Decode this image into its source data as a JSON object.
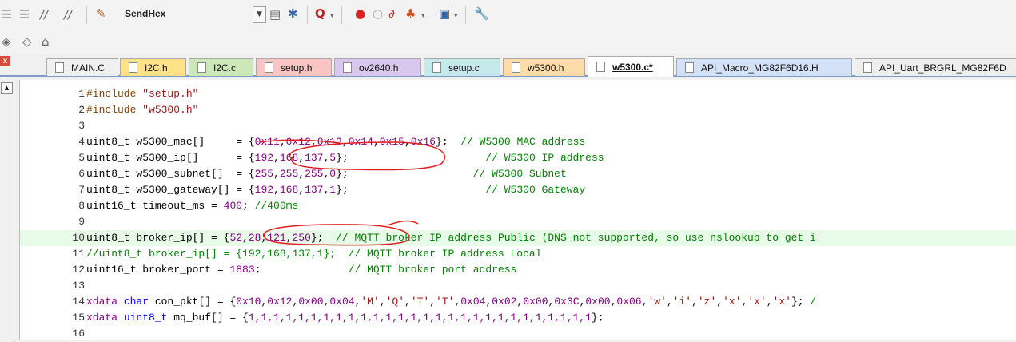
{
  "toolbar": {
    "combo_value": "SendHex",
    "icons": [
      "indent-icon",
      "outdent-icon",
      "comment-icon",
      "uncomment-icon",
      "wizard-icon",
      "combo-dropdown-icon",
      "find-in-files-icon",
      "replace-icon",
      "debug-icon",
      "breakpoint-icon",
      "breakpoint-disable-icon",
      "breakpoint-kill-icon",
      "breakpoint-all-icon",
      "window-icon",
      "settings-icon",
      "bookmark-icon",
      "bookmark-prev-icon",
      "bookmark-next-icon"
    ]
  },
  "tabs": [
    {
      "label": "MAIN.C",
      "color": "#f0f0f0",
      "active": false
    },
    {
      "label": "I2C.h",
      "color": "#fde28a",
      "active": false
    },
    {
      "label": "I2C.c",
      "color": "#cde8b8",
      "active": false
    },
    {
      "label": "setup.h",
      "color": "#f9c4c4",
      "active": false
    },
    {
      "label": "ov2640.h",
      "color": "#d8c8ee",
      "active": false
    },
    {
      "label": "setup.c",
      "color": "#c6e9ec",
      "active": false
    },
    {
      "label": "w5300.h",
      "color": "#fcdca8",
      "active": false
    },
    {
      "label": "w5300.c*",
      "color": "#ffffff",
      "active": true
    },
    {
      "label": "API_Macro_MG82F6D16.H",
      "color": "#d4e2f8",
      "active": false
    },
    {
      "label": "API_Uart_BRGRL_MG82F6D",
      "color": "#eeeeee",
      "active": false
    }
  ],
  "lines": [
    {
      "n": "1",
      "parts": [
        [
          "pp",
          "#include "
        ],
        [
          "str",
          "\"setup.h\""
        ]
      ]
    },
    {
      "n": "2",
      "parts": [
        [
          "pp",
          "#include "
        ],
        [
          "str",
          "\"w5300.h\""
        ]
      ]
    },
    {
      "n": "3",
      "parts": []
    },
    {
      "n": "4",
      "parts": [
        [
          "",
          "uint8_t w5300_mac[]     = {"
        ],
        [
          "num",
          "0x11"
        ],
        [
          "",
          ","
        ],
        [
          "num",
          "0x12"
        ],
        [
          "",
          ","
        ],
        [
          "num",
          "0x13"
        ],
        [
          "",
          ","
        ],
        [
          "num",
          "0x14"
        ],
        [
          "",
          ","
        ],
        [
          "num",
          "0x15"
        ],
        [
          "",
          ","
        ],
        [
          "num",
          "0x16"
        ],
        [
          "",
          "};  "
        ],
        [
          "cmt",
          "// W5300 MAC address"
        ]
      ]
    },
    {
      "n": "5",
      "parts": [
        [
          "",
          "uint8_t w5300_ip[]      = {"
        ],
        [
          "num",
          "192"
        ],
        [
          "",
          ","
        ],
        [
          "num",
          "168"
        ],
        [
          "",
          ","
        ],
        [
          "num",
          "137"
        ],
        [
          "",
          ","
        ],
        [
          "num",
          "5"
        ],
        [
          "",
          "};                      "
        ],
        [
          "cmt",
          "// W5300 IP address"
        ]
      ]
    },
    {
      "n": "6",
      "parts": [
        [
          "",
          "uint8_t w5300_subnet[]  = {"
        ],
        [
          "num",
          "255"
        ],
        [
          "",
          ","
        ],
        [
          "num",
          "255"
        ],
        [
          "",
          ","
        ],
        [
          "num",
          "255"
        ],
        [
          "",
          ","
        ],
        [
          "num",
          "0"
        ],
        [
          "",
          "};                    "
        ],
        [
          "cmt",
          "// W5300 Subnet"
        ]
      ]
    },
    {
      "n": "7",
      "parts": [
        [
          "",
          "uint8_t w5300_gateway[] = {"
        ],
        [
          "num",
          "192"
        ],
        [
          "",
          ","
        ],
        [
          "num",
          "168"
        ],
        [
          "",
          ","
        ],
        [
          "num",
          "137"
        ],
        [
          "",
          ","
        ],
        [
          "num",
          "1"
        ],
        [
          "",
          "};                      "
        ],
        [
          "cmt",
          "// W5300 Gateway"
        ]
      ]
    },
    {
      "n": "8",
      "parts": [
        [
          "",
          "uint16_t timeout_ms = "
        ],
        [
          "num",
          "400"
        ],
        [
          "",
          "; "
        ],
        [
          "cmt",
          "//400ms"
        ]
      ]
    },
    {
      "n": "9",
      "parts": []
    },
    {
      "n": "10",
      "parts": [
        [
          "",
          "uint8_t broker_ip[] = {"
        ],
        [
          "num",
          "52"
        ],
        [
          "",
          ","
        ],
        [
          "num",
          "28"
        ],
        [
          "",
          ","
        ],
        [
          "num",
          "121"
        ],
        [
          "",
          ","
        ],
        [
          "num",
          "250"
        ],
        [
          "",
          "};  "
        ],
        [
          "cmt",
          "// MQTT broker IP address Public (DNS not supported, so use nslookup to get i"
        ]
      ],
      "hl": true
    },
    {
      "n": "11",
      "parts": [
        [
          "cmt",
          "//uint8_t broker_ip[] = {192,168,137,1};  // MQTT broker IP address Local"
        ]
      ]
    },
    {
      "n": "12",
      "parts": [
        [
          "",
          "uint16_t broker_port = "
        ],
        [
          "num",
          "1883"
        ],
        [
          "",
          ";              "
        ],
        [
          "cmt",
          "// MQTT broker port address"
        ]
      ]
    },
    {
      "n": "13",
      "parts": []
    },
    {
      "n": "14",
      "parts": [
        [
          "kw2",
          "xdata "
        ],
        [
          "kw",
          "char"
        ],
        [
          "",
          " con_pkt[] = {"
        ],
        [
          "num",
          "0x10"
        ],
        [
          "",
          ","
        ],
        [
          "num",
          "0x12"
        ],
        [
          "",
          ","
        ],
        [
          "num",
          "0x00"
        ],
        [
          "",
          ","
        ],
        [
          "num",
          "0x04"
        ],
        [
          "",
          ","
        ],
        [
          "str",
          "'M'"
        ],
        [
          "",
          ","
        ],
        [
          "str",
          "'Q'"
        ],
        [
          "",
          ","
        ],
        [
          "str",
          "'T'"
        ],
        [
          "",
          ","
        ],
        [
          "str",
          "'T'"
        ],
        [
          "",
          ","
        ],
        [
          "num",
          "0x04"
        ],
        [
          "",
          ","
        ],
        [
          "num",
          "0x02"
        ],
        [
          "",
          ","
        ],
        [
          "num",
          "0x00"
        ],
        [
          "",
          ","
        ],
        [
          "num",
          "0x3C"
        ],
        [
          "",
          ","
        ],
        [
          "num",
          "0x00"
        ],
        [
          "",
          ","
        ],
        [
          "num",
          "0x06"
        ],
        [
          "",
          ","
        ],
        [
          "str",
          "'w'"
        ],
        [
          "",
          ","
        ],
        [
          "str",
          "'i'"
        ],
        [
          "",
          ","
        ],
        [
          "str",
          "'z'"
        ],
        [
          "",
          ","
        ],
        [
          "str",
          "'x'"
        ],
        [
          "",
          ","
        ],
        [
          "str",
          "'x'"
        ],
        [
          "",
          ","
        ],
        [
          "str",
          "'x'"
        ],
        [
          "",
          "}; "
        ],
        [
          "cmt",
          "/"
        ]
      ]
    },
    {
      "n": "15",
      "parts": [
        [
          "kw2",
          "xdata "
        ],
        [
          "kw",
          "uint8_t"
        ],
        [
          "",
          " mq_buf[] = {"
        ],
        [
          "num",
          "1,1,1,1,1,1,1,1,1,1,1,1,1,1,1,1,1,1,1,1,1,1,1,1,1,1,1,1"
        ],
        [
          "",
          "};"
        ]
      ]
    },
    {
      "n": "16",
      "parts": []
    }
  ],
  "colors": {
    "accent": "#7a9cc6",
    "highlight_line": "#e8fae8",
    "annotation": "#e02020"
  }
}
